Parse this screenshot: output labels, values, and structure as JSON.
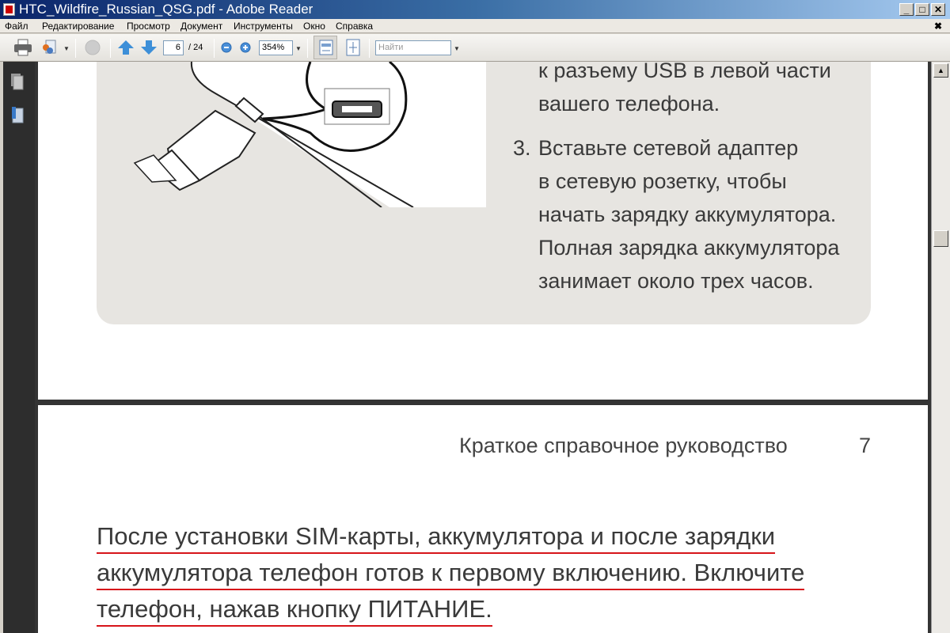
{
  "window": {
    "title": "HTC_Wildfire_Russian_QSG.pdf - Adobe Reader",
    "minimize": "_",
    "maximize": "□",
    "close": "✕",
    "doc_close": "✖"
  },
  "menu": [
    "Файл",
    "Редактирование",
    "Просмотр",
    "Документ",
    "Инструменты",
    "Окно",
    "Справка"
  ],
  "toolbar": {
    "page_current": "6",
    "page_total": "/ 24",
    "zoom": "354%",
    "find_placeholder": "Найти"
  },
  "page1": {
    "lines": [
      "к разъему USB в левой части",
      "вашего телефона."
    ],
    "step_number": "3.",
    "step_lines": [
      "Вставьте сетевой адаптер",
      "в сетевую розетку, чтобы",
      "начать зарядку аккумулятора.",
      "Полная зарядка аккумулятора",
      "занимает около трех часов."
    ]
  },
  "page2": {
    "header": "Краткое справочное руководство",
    "page_number": "7",
    "body_lines": [
      "После установки SIM-карты, аккумулятора и после зарядки",
      "аккумулятора телефон готов к первому включению. Включите",
      "телефон, нажав кнопку ПИТАНИЕ."
    ]
  },
  "colors": {
    "underline": "#d7141a",
    "titlebar": "#0a246a",
    "panel": "#e7e5e1"
  }
}
